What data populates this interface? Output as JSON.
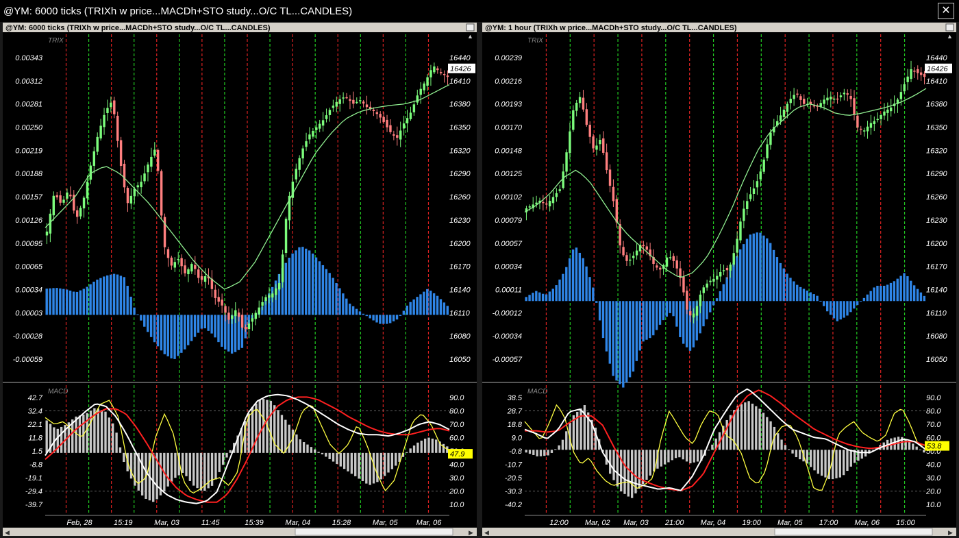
{
  "window": {
    "title": "@YM: 6000 ticks (TRIXh w price...MACDh+STO study...O/C TL...CANDLES)",
    "close_glyph": "✕"
  },
  "panels": [
    {
      "title": "@YM: 6000 ticks (TRIXh w price...MACDh+STO study...O/C TL...CANDLES)",
      "upper_label": "TRIX",
      "lower_label": "MACD",
      "trix_ticks": [
        "0.00343",
        "0.00312",
        "0.00281",
        "0.00250",
        "0.00219",
        "0.00188",
        "0.00157",
        "0.00126",
        "0.00095",
        "0.00065",
        "0.00034",
        "0.00003",
        "-0.00028",
        "-0.00059"
      ],
      "price_ticks": [
        "16440",
        "16410",
        "16380",
        "16350",
        "16320",
        "16290",
        "16260",
        "16230",
        "16200",
        "16170",
        "16140",
        "16110",
        "16080",
        "16050"
      ],
      "price_last": "16426",
      "macd_ticks": [
        "42.7",
        "32.4",
        "22.1",
        "11.8",
        "1.5",
        "-8.8",
        "-19.1",
        "-29.4",
        "-39.7"
      ],
      "sto_ticks": [
        "90.0",
        "80.0",
        "70.0",
        "60.0",
        "50.0",
        "40.0",
        "30.0",
        "20.0",
        "10.0"
      ],
      "sto_last": "47.9",
      "time_labels": [
        "Feb, 28",
        "15:19",
        "Mar, 03",
        "11:45",
        "15:39",
        "Mar, 04",
        "15:28",
        "Mar, 05",
        "Mar, 06"
      ]
    },
    {
      "title": "@YM: 1 hour (TRIXh w price...MACDh+STO study...O/C TL...CANDLES)",
      "upper_label": "TRIX",
      "lower_label": "MACD",
      "trix_ticks": [
        "0.00239",
        "0.00216",
        "0.00193",
        "0.00170",
        "0.00148",
        "0.00125",
        "0.00102",
        "0.00079",
        "0.00057",
        "0.00034",
        "0.00011",
        "-0.00012",
        "-0.00034",
        "-0.00057"
      ],
      "price_ticks": [
        "16440",
        "16410",
        "16380",
        "16350",
        "16320",
        "16290",
        "16260",
        "16230",
        "16200",
        "16170",
        "16140",
        "16110",
        "16080",
        "16050"
      ],
      "price_last": "16426",
      "macd_ticks": [
        "38.5",
        "28.7",
        "18.8",
        "9.0",
        "-0.8",
        "-10.7",
        "-20.5",
        "-30.3",
        "-40.2"
      ],
      "sto_ticks": [
        "90.0",
        "80.0",
        "70.0",
        "60.0",
        "50.0",
        "40.0",
        "30.0",
        "20.0",
        "10.0"
      ],
      "sto_last": "53.8",
      "time_labels": [
        "12:00",
        "Mar, 02",
        "Mar, 03",
        "21:00",
        "Mar, 04",
        "19:00",
        "Mar, 05",
        "17:00",
        "Mar, 06",
        "15:00"
      ]
    }
  ],
  "colors": {
    "up_candle": "#7CFC7C",
    "down_candle": "#FF7F7F",
    "trix_hist": "#2F86E8",
    "ma_line": "#90EE90",
    "macd_hist": "#C8C8C8",
    "macd_line": "#FFFFFF",
    "signal_line": "#FF2020",
    "sto_line": "#FFFF40",
    "buy_line": "#22CC22",
    "sell_line": "#DD2222"
  },
  "chart_data": [
    {
      "type": "candlestick",
      "panel": "6000 ticks",
      "price_close_path": [
        16215,
        16265,
        16250,
        16270,
        16230,
        16255,
        16300,
        16340,
        16370,
        16385,
        16310,
        16250,
        16270,
        16280,
        16305,
        16325,
        16200,
        16170,
        16180,
        16160,
        16175,
        16150,
        16160,
        16130,
        16120,
        16100,
        16115,
        16085,
        16100,
        16115,
        16130,
        16135,
        16150,
        16250,
        16290,
        16320,
        16340,
        16350,
        16360,
        16375,
        16385,
        16390,
        16380,
        16385,
        16375,
        16370,
        16360,
        16345,
        16335,
        16355,
        16370,
        16395,
        16410,
        16430,
        16420,
        16415
      ],
      "price_ma_path": [
        16220,
        16240,
        16260,
        16290,
        16300,
        16290,
        16270,
        16250,
        16225,
        16200,
        16175,
        16155,
        16140,
        16150,
        16175,
        16210,
        16245,
        16280,
        16315,
        16340,
        16360,
        16370,
        16375,
        16378,
        16380,
        16385,
        16395,
        16405
      ],
      "trix_histogram_path": [
        0.00035,
        0.00036,
        0.00034,
        0.0003,
        0.00036,
        0.00046,
        0.00052,
        0.00055,
        0.0005,
        8e-05,
        -0.00016,
        -0.00036,
        -0.00052,
        -0.0006,
        -0.00048,
        -0.00032,
        -0.00016,
        -0.00026,
        -0.00044,
        -0.00052,
        -0.00044,
        -5e-05,
        0.0001,
        0.00035,
        0.0006,
        0.0008,
        0.00092,
        0.00085,
        0.0007,
        0.00055,
        0.00035,
        0.00015,
        5e-05,
        -4e-05,
        -0.00012,
        -0.00012,
        -5e-05,
        0.00015,
        0.00025,
        0.00035,
        0.00025,
        0.00012
      ],
      "macd_histogram_path": [
        25,
        18,
        22,
        28,
        30,
        35,
        32,
        20,
        -10,
        -25,
        -35,
        -38,
        -30,
        -20,
        -15,
        -25,
        -30,
        -25,
        -10,
        5,
        20,
        35,
        42,
        40,
        30,
        20,
        10,
        5,
        0,
        -5,
        -10,
        -15,
        -20,
        -25,
        -22,
        -15,
        -8,
        2,
        8,
        12,
        10,
        5
      ],
      "macd_line_path": [
        -2,
        10,
        18,
        25,
        32,
        38,
        36,
        28,
        15,
        0,
        -15,
        -25,
        -32,
        -36,
        -38,
        -39,
        -37,
        -30,
        -10,
        10,
        30,
        40,
        44,
        45,
        44,
        41,
        37,
        32,
        27,
        22,
        18,
        15,
        14,
        14,
        13,
        15,
        18,
        22,
        24,
        22,
        18
      ],
      "signal_line_path": [
        -5,
        2,
        10,
        18,
        24,
        30,
        34,
        34,
        30,
        20,
        8,
        -5,
        -18,
        -27,
        -33,
        -36,
        -38,
        -38,
        -32,
        -20,
        -5,
        12,
        26,
        36,
        41,
        43,
        43,
        41,
        37,
        33,
        28,
        24,
        20,
        17,
        15,
        14,
        14,
        16,
        18,
        19,
        17
      ],
      "stochastic_path": [
        75,
        70,
        72,
        65,
        60,
        72,
        85,
        88,
        75,
        40,
        25,
        30,
        60,
        78,
        62,
        28,
        18,
        22,
        28,
        30,
        24,
        35,
        75,
        82,
        72,
        55,
        48,
        60,
        80,
        85,
        70,
        55,
        48,
        55,
        70,
        55,
        35,
        20,
        28,
        50,
        72,
        78,
        70,
        55,
        50
      ],
      "buy_signals": 9,
      "sell_signals": 8
    },
    {
      "type": "candlestick",
      "panel": "1 hour",
      "price_close_path": [
        16245,
        16250,
        16255,
        16250,
        16260,
        16270,
        16320,
        16375,
        16390,
        16350,
        16320,
        16335,
        16290,
        16250,
        16190,
        16175,
        16185,
        16200,
        16190,
        16170,
        16165,
        16185,
        16175,
        16150,
        16105,
        16110,
        16140,
        16150,
        16155,
        16165,
        16165,
        16195,
        16240,
        16260,
        16275,
        16300,
        16340,
        16355,
        16370,
        16385,
        16395,
        16380,
        16380,
        16375,
        16385,
        16390,
        16385,
        16395,
        16390,
        16350,
        16345,
        16355,
        16360,
        16370,
        16375,
        16385,
        16405,
        16425,
        16420,
        16415
      ],
      "price_ma_path": [
        16240,
        16250,
        16265,
        16285,
        16295,
        16280,
        16255,
        16230,
        16210,
        16195,
        16180,
        16165,
        16155,
        16162,
        16180,
        16210,
        16245,
        16285,
        16320,
        16345,
        16360,
        16375,
        16380,
        16376,
        16368,
        16365,
        16368,
        16372,
        16376,
        16382,
        16390,
        16400
      ],
      "trix_histogram_path": [
        4e-05,
        0.0001,
        6e-05,
        0.00014,
        0.0003,
        0.00055,
        0.0004,
        0.0001,
        -0.0004,
        -0.00075,
        -0.00085,
        -0.0007,
        -0.0004,
        -0.00035,
        -0.0002,
        -0.0001,
        -0.0004,
        -0.0005,
        -0.0003,
        -0.0001,
        0.0001,
        0.0003,
        0.0005,
        0.00065,
        0.00068,
        0.0006,
        0.0004,
        0.00025,
        0.00015,
        0.0001,
        5e-05,
        -0.0001,
        -0.0002,
        -0.00015,
        -5e-05,
        5e-05,
        0.00015,
        0.00015,
        0.0002,
        0.00028,
        0.00015,
        5e-05
      ],
      "macd_histogram_path": [
        -2,
        -5,
        -4,
        5,
        25,
        33,
        15,
        -15,
        -30,
        -36,
        -25,
        -15,
        -10,
        -5,
        -10,
        -8,
        5,
        20,
        32,
        36,
        30,
        20,
        5,
        -5,
        -10,
        -18,
        -22,
        -20,
        -10,
        -5,
        2,
        8,
        10,
        5,
        -2
      ],
      "macd_line_path": [
        15,
        12,
        8,
        15,
        28,
        30,
        20,
        -2,
        -15,
        -22,
        -25,
        -27,
        -29,
        -28,
        -30,
        -20,
        -5,
        15,
        28,
        40,
        45,
        38,
        30,
        22,
        15,
        12,
        9,
        8,
        4,
        0,
        -2,
        -2,
        2,
        5,
        8,
        6,
        0
      ],
      "signal_line_path": [
        14,
        14,
        13,
        14,
        20,
        25,
        25,
        18,
        2,
        -12,
        -20,
        -24,
        -27,
        -29,
        -30,
        -27,
        -18,
        -2,
        14,
        30,
        40,
        44,
        40,
        34,
        27,
        21,
        15,
        11,
        7,
        4,
        2,
        1,
        2,
        4,
        6,
        6,
        3
      ],
      "stochastic_path": [
        72,
        65,
        58,
        70,
        85,
        75,
        50,
        40,
        45,
        35,
        28,
        24,
        26,
        27,
        22,
        25,
        30,
        60,
        80,
        70,
        60,
        55,
        70,
        80,
        78,
        62,
        58,
        48,
        30,
        25,
        35,
        60,
        68,
        70,
        60,
        42,
        22,
        20,
        35,
        62,
        68,
        72,
        64,
        60,
        57,
        62,
        78,
        82,
        70,
        55,
        54
      ],
      "buy_signals": 8,
      "sell_signals": 8
    }
  ]
}
